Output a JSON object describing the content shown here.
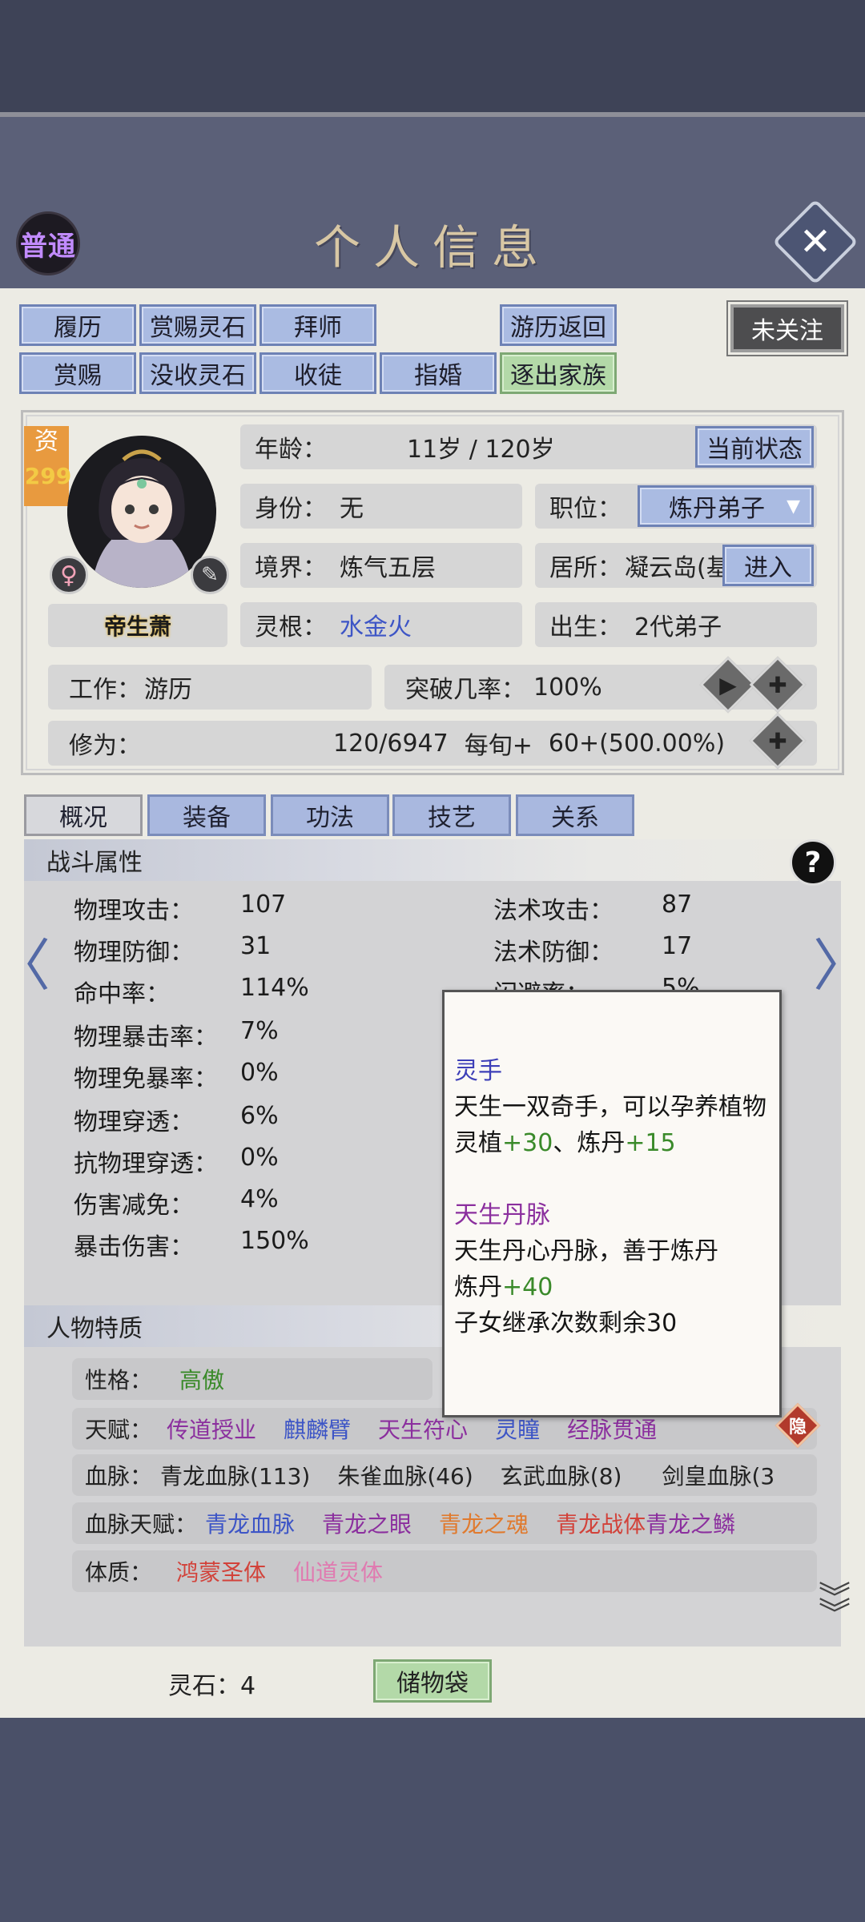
{
  "header": {
    "mode_badge": "普通",
    "title": "个人信息",
    "follow_label": "未关注"
  },
  "actions": {
    "row1": [
      "履历",
      "赏赐灵石",
      "拜师",
      "游历返回"
    ],
    "row2": [
      "赏赐",
      "没收灵石",
      "收徒",
      "指婚",
      "逐出家族"
    ]
  },
  "profile": {
    "talent_label": "资",
    "talent_value": "299",
    "name": "帝生萧",
    "age_label": "年龄：",
    "age_value": "11岁 / 120岁",
    "status_button": "当前状态",
    "identity_label": "身份：",
    "identity_value": "无",
    "position_label": "职位：",
    "position_value": "炼丹弟子",
    "realm_label": "境界：",
    "realm_value": "炼气五层",
    "residence_label": "居所：",
    "residence_value": "凝云岛(基",
    "enter_button": "进入",
    "root_label": "灵根：",
    "root_value": "水金火",
    "birth_label": "出生：",
    "birth_value": "2代弟子",
    "work_label": "工作：",
    "work_value": "游历",
    "breakthrough_label": "突破几率：",
    "breakthrough_value": "100%",
    "cultivation_label": "修为：",
    "cultivation_value": "120/6947",
    "cultivation_rate_label": "每旬+",
    "cultivation_rate_value": "60+(500.00%)"
  },
  "tabs": [
    "概况",
    "装备",
    "功法",
    "技艺",
    "关系"
  ],
  "combat": {
    "title": "战斗属性",
    "left": [
      {
        "label": "物理攻击：",
        "value": "107"
      },
      {
        "label": "物理防御：",
        "value": "31"
      },
      {
        "label": "命中率：",
        "value": "114%"
      },
      {
        "label": "物理暴击率：",
        "value": "7%"
      },
      {
        "label": "物理免暴率：",
        "value": "0%"
      },
      {
        "label": "物理穿透：",
        "value": "6%"
      },
      {
        "label": "抗物理穿透：",
        "value": "0%"
      },
      {
        "label": "伤害减免：",
        "value": "4%"
      },
      {
        "label": "暴击伤害：",
        "value": "150%"
      }
    ],
    "right": [
      {
        "label": "法术攻击：",
        "value": "87"
      },
      {
        "label": "法术防御：",
        "value": "17"
      },
      {
        "label": "闪避率：",
        "value": "5%"
      }
    ]
  },
  "traits": {
    "title": "人物特质",
    "personality_label": "性格：",
    "personality_value": "高傲",
    "gift_label": "天赋：",
    "gifts": [
      "传道授业",
      "麒麟臂",
      "天生符心",
      "灵瞳",
      "经脉贯通"
    ],
    "hidden_badge": "隐",
    "bloodline_label": "血脉：",
    "bloodlines": [
      "青龙血脉(113)",
      "朱雀血脉(46)",
      "玄武血脉(8)",
      "剑皇血脉(3"
    ],
    "bloodline_gift_label": "血脉天赋：",
    "bloodline_gifts": [
      "青龙血脉",
      "青龙之眼",
      "青龙之魂",
      "青龙战体",
      "青龙之鳞"
    ],
    "physique_label": "体质：",
    "physiques": [
      "鸿蒙圣体",
      "仙道灵体"
    ]
  },
  "tooltip": {
    "title1": "灵手",
    "desc1": "天生一双奇手，可以孕养植物",
    "bonus1_a": "灵植",
    "bonus1_a_val": "+30",
    "bonus1_sep": "、",
    "bonus1_b": "炼丹",
    "bonus1_b_val": "+15",
    "title2": "天生丹脉",
    "desc2": "天生丹心丹脉，善于炼丹",
    "bonus2": "炼丹",
    "bonus2_val": "+40",
    "note": "子女继承次数剩余30"
  },
  "footer": {
    "spirit_stone": "灵石：4",
    "bag_button": "储物袋"
  },
  "colors": {
    "button_blue": "#aabbe2",
    "button_green": "#b3d9a8",
    "accent_blue": "#3d55c6",
    "purple": "#8b2f9e",
    "red": "#d2423a",
    "orange": "#e07a2e",
    "pink": "#e07ab0",
    "green": "#3a8a2a"
  }
}
